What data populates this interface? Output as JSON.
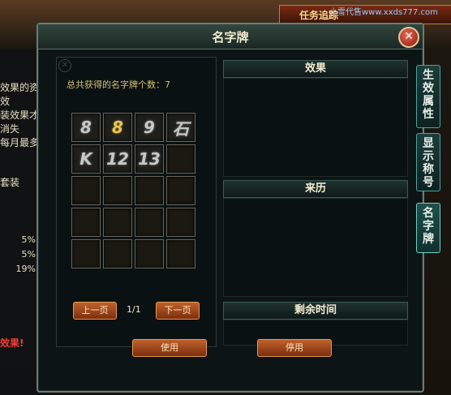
{
  "watermark": "小雪代售www.xxds777.com",
  "background": {
    "quest_bar": "任务追踪",
    "left_text": [
      "效果的资",
      "效",
      "装效果才",
      "消失",
      "每月最多"
    ],
    "left_green_label": "套装",
    "left_pct": [
      "",
      "",
      "",
      "5%",
      "5%",
      "19%"
    ],
    "left_red": "效果!"
  },
  "window": {
    "title": "名字牌",
    "close_label": "✕"
  },
  "left_panel": {
    "count_text": "总共获得的名字牌个数：7",
    "slots": [
      "8",
      "8",
      "9",
      "石",
      "K",
      "12",
      "13",
      "",
      "",
      "",
      "",
      "",
      "",
      "",
      "",
      "",
      "",
      "",
      "",
      ""
    ],
    "slot_colors": [
      "#c8c8c8",
      "#f2c53a",
      "#c8c8c8",
      "#c8c8c8",
      "#c8c8c8",
      "#c8c8c8",
      "#c8c8c8"
    ],
    "prev_label": "上一页",
    "next_label": "下一页",
    "page": "1/1"
  },
  "right_panel": {
    "effect_header": "效果",
    "origin_header": "来历",
    "remaining_header": "剩余时间"
  },
  "buttons": {
    "use_label": "使用",
    "stop_label": "停用"
  },
  "side_tabs": [
    {
      "label": "生效属性"
    },
    {
      "label": "显示称号"
    },
    {
      "label": "名字牌",
      "active": true
    }
  ]
}
